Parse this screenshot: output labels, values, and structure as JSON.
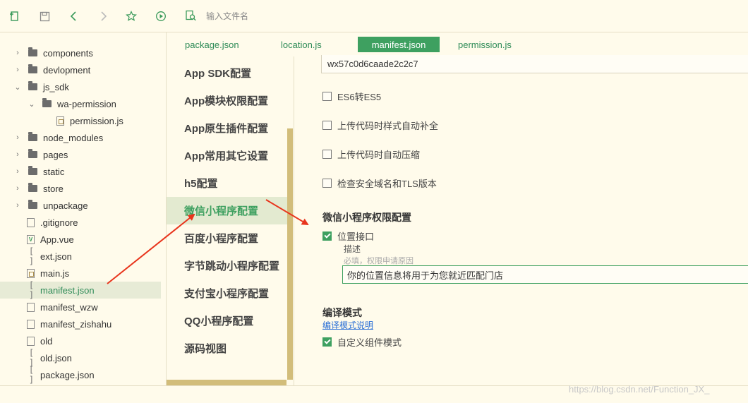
{
  "toolbar": {
    "search_placeholder": "输入文件名"
  },
  "tree": {
    "items": [
      {
        "label": "components",
        "kind": "folder",
        "expand": "closed"
      },
      {
        "label": "devlopment",
        "kind": "folder",
        "expand": "closed"
      },
      {
        "label": "js_sdk",
        "kind": "folder",
        "expand": "open"
      },
      {
        "label": "wa-permission",
        "kind": "folder",
        "expand": "open"
      },
      {
        "label": "permission.js",
        "kind": "js"
      },
      {
        "label": "node_modules",
        "kind": "folder",
        "expand": "closed"
      },
      {
        "label": "pages",
        "kind": "folder",
        "expand": "closed"
      },
      {
        "label": "static",
        "kind": "folder",
        "expand": "closed"
      },
      {
        "label": "store",
        "kind": "folder",
        "expand": "closed"
      },
      {
        "label": "unpackage",
        "kind": "folder",
        "expand": "closed"
      },
      {
        "label": ".gitignore",
        "kind": "file"
      },
      {
        "label": "App.vue",
        "kind": "vue"
      },
      {
        "label": "ext.json",
        "kind": "json"
      },
      {
        "label": "main.js",
        "kind": "js"
      },
      {
        "label": "manifest.json",
        "kind": "json",
        "active": true
      },
      {
        "label": "manifest_wzw",
        "kind": "file"
      },
      {
        "label": "manifest_zishahu",
        "kind": "file"
      },
      {
        "label": "old",
        "kind": "file"
      },
      {
        "label": "old.json",
        "kind": "json"
      },
      {
        "label": "package.json",
        "kind": "json"
      }
    ]
  },
  "tabs": [
    {
      "label": "package.json"
    },
    {
      "label": "location.js"
    },
    {
      "label": "manifest.json",
      "active": true
    },
    {
      "label": "permission.js"
    }
  ],
  "settings_nav": [
    {
      "label": "App SDK配置"
    },
    {
      "label": "App模块权限配置"
    },
    {
      "label": "App原生插件配置"
    },
    {
      "label": "App常用其它设置"
    },
    {
      "label": "h5配置"
    },
    {
      "label": "微信小程序配置",
      "active": true
    },
    {
      "label": "百度小程序配置"
    },
    {
      "label": "字节跳动小程序配置"
    },
    {
      "label": "支付宝小程序配置"
    },
    {
      "label": "QQ小程序配置"
    },
    {
      "label": "源码视图"
    }
  ],
  "form": {
    "appid_value": "wx57c0d6caade2c2c7",
    "es6": {
      "label": "ES6转ES5",
      "checked": false
    },
    "postcss": {
      "label": "上传代码时样式自动补全",
      "checked": false
    },
    "minify": {
      "label": "上传代码时自动压缩",
      "checked": false
    },
    "urlcheck": {
      "label": "检查安全域名和TLS版本",
      "checked": false
    },
    "permission_title": "微信小程序权限配置",
    "location": {
      "label": "位置接口",
      "checked": true
    },
    "desc_label": "描述",
    "desc_hint": "必填，权限申请原因",
    "desc_value": "你的位置信息将用于为您就近匹配门店",
    "compile_title": "编译模式",
    "compile_link": "编译模式说明",
    "custom_component": {
      "label": "自定义组件模式",
      "checked": true
    }
  },
  "watermark": "https://blog.csdn.net/Function_JX_",
  "colors": {
    "accent": "#3ea060",
    "background": "#fffbeb",
    "arrow": "#e8341c",
    "scrollbar": "#d2bd7a"
  }
}
